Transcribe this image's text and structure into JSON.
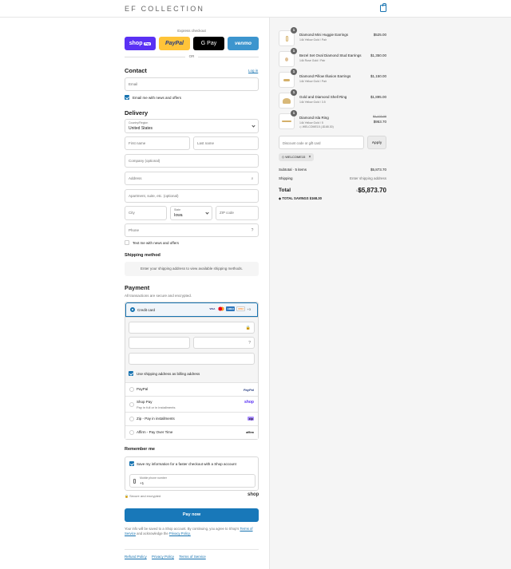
{
  "header": {
    "logo": "EF COLLECTION"
  },
  "express": {
    "label": "Express checkout",
    "shop": "shop",
    "shop_pill": "Pay",
    "paypal": "PayPal",
    "gpay": "G Pay",
    "venmo": "venmo",
    "or": "OR"
  },
  "contact": {
    "title": "Contact",
    "login": "Log in",
    "email_placeholder": "Email",
    "news_label": "Email me with news and offers"
  },
  "delivery": {
    "title": "Delivery",
    "country_label": "Country/Region",
    "country_value": "United States",
    "first_name": "First name",
    "last_name": "Last name",
    "company": "Company (optional)",
    "address": "Address",
    "apartment": "Apartment, suite, etc. (optional)",
    "city": "City",
    "state_label": "State",
    "state_value": "Iowa",
    "zip": "ZIP code",
    "phone": "Phone",
    "text_news": "Text me with news and offers"
  },
  "shipping": {
    "title": "Shipping method",
    "note": "Enter your shipping address to view available shipping methods."
  },
  "payment": {
    "title": "Payment",
    "subtitle": "All transactions are secure and encrypted.",
    "credit_card": "Credit card",
    "card_logos": [
      "VISA",
      "MC",
      "AMEX",
      "DISC"
    ],
    "more_cards": "+3",
    "billing_same": "Use shipping address as billing address",
    "paypal": "PayPal",
    "paypal_brand": "PayPal",
    "shop_pay": "Shop Pay",
    "shop_pay_sub": "Pay in full or in installments",
    "shop_brand": "shop",
    "zip": "Zip - Pay in installments",
    "zip_brand": "zip",
    "affirm": "Affirm - Pay Over Time",
    "affirm_brand": "affirm"
  },
  "remember": {
    "title": "Remember me",
    "save_info": "Save my information for a faster checkout with a Shop account",
    "phone_label": "Mobile phone number",
    "phone_value": "+1",
    "secure": "Secure and encrypted",
    "shop_brand": "shop"
  },
  "pay_now": "Pay now",
  "legal": {
    "text1": "Your info will be saved to a Shop account. By continuing, you agree to Shop's",
    "tos": "Terms of Service",
    "text2": "and acknowledge the",
    "privacy": "Privacy Policy."
  },
  "footer": {
    "links": [
      "Refund Policy",
      "Privacy Policy",
      "Terms of Service"
    ]
  },
  "order": {
    "items": [
      {
        "qty": "1",
        "name": "Diamond Mini Huggie Earrings",
        "variant": "14k Yellow Gold / Pair",
        "price": "$525.00"
      },
      {
        "qty": "1",
        "name": "Bezel Set Oval Diamond Stud Earrings",
        "variant": "14k Rose Gold / Pair",
        "price": "$1,350.00"
      },
      {
        "qty": "1",
        "name": "Diamond Pillow Illusion Earrings",
        "variant": "14k Yellow Gold / Pair",
        "price": "$1,150.00"
      },
      {
        "qty": "1",
        "name": "Gold and Diamond Shell Ring",
        "variant": "14k Yellow Gold / 3.5",
        "price": "$1,895.00"
      },
      {
        "qty": "1",
        "name": "Diamond Isla Ring",
        "variant": "14k Yellow Gold / 5",
        "discount": "WELCOME15 (-$168.30)",
        "orig_price": "$1,122.00",
        "price": "$953.70"
      }
    ],
    "discount_placeholder": "Discount code or gift card",
    "apply": "Apply",
    "applied_code": "WELCOME15",
    "subtotal_label": "Subtotal · 5 items",
    "subtotal_value": "$5,873.70",
    "shipping_label": "Shipping",
    "shipping_value": "Enter shipping address",
    "total_label": "Total",
    "currency": "USD",
    "total_value": "$5,873.70",
    "savings": "TOTAL SAVINGS  $168.30"
  }
}
